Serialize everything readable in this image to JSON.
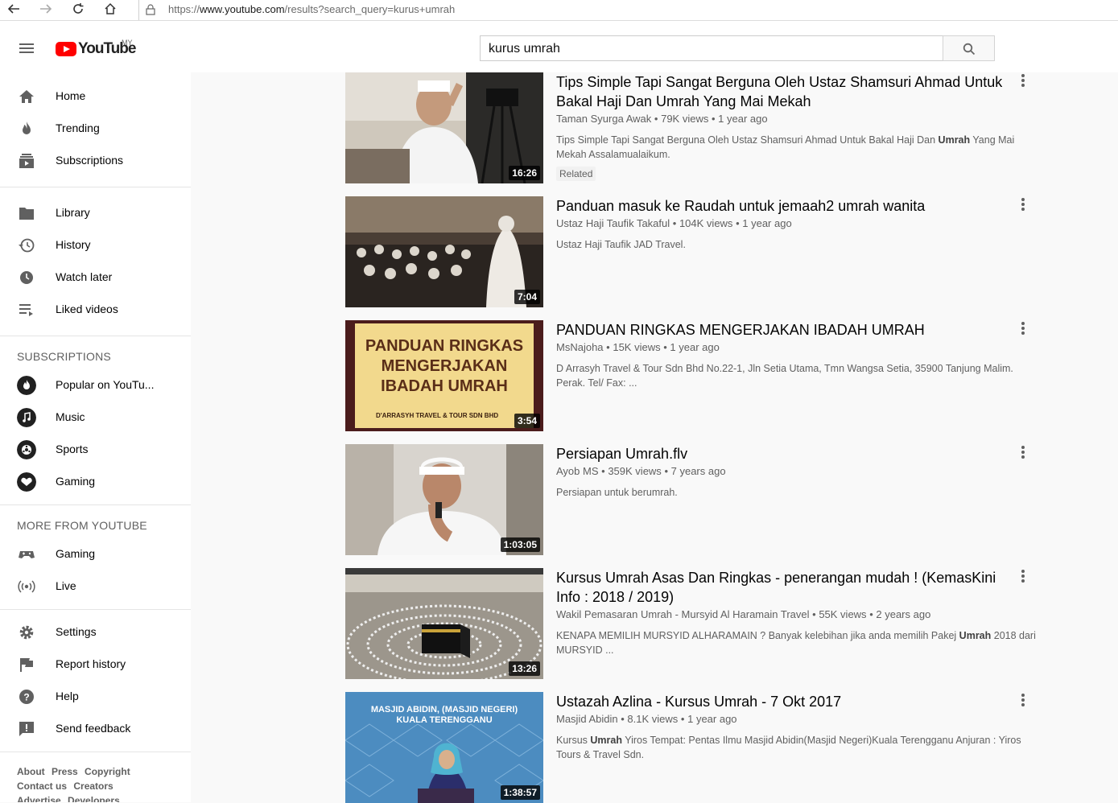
{
  "browser": {
    "url_prefix": "https://",
    "url_host": "www.youtube.com",
    "url_path": "/results?search_query=kurus+umrah"
  },
  "masthead": {
    "logo_text": "YouTube",
    "region": "MY",
    "search_value": "kurus umrah"
  },
  "sidebar": {
    "main": [
      {
        "label": "Home",
        "icon": "home-icon"
      },
      {
        "label": "Trending",
        "icon": "flame-icon"
      },
      {
        "label": "Subscriptions",
        "icon": "subscriptions-icon"
      }
    ],
    "library": [
      {
        "label": "Library",
        "icon": "folder-icon"
      },
      {
        "label": "History",
        "icon": "history-icon"
      },
      {
        "label": "Watch later",
        "icon": "clock-icon"
      },
      {
        "label": "Liked videos",
        "icon": "playlist-icon"
      }
    ],
    "subscriptions_heading": "SUBSCRIPTIONS",
    "subscriptions": [
      {
        "label": "Popular on YouTu..."
      },
      {
        "label": "Music"
      },
      {
        "label": "Sports"
      },
      {
        "label": "Gaming"
      }
    ],
    "more_heading": "MORE FROM YOUTUBE",
    "more": [
      {
        "label": "Gaming",
        "icon": "gamepad-icon"
      },
      {
        "label": "Live",
        "icon": "live-icon"
      }
    ],
    "settings": [
      {
        "label": "Settings",
        "icon": "gear-icon"
      },
      {
        "label": "Report history",
        "icon": "flag-icon"
      },
      {
        "label": "Help",
        "icon": "help-icon"
      },
      {
        "label": "Send feedback",
        "icon": "feedback-icon"
      }
    ],
    "footer_row1": [
      "About",
      "Press",
      "Copyright"
    ],
    "footer_row2": [
      "Contact us",
      "Creators"
    ],
    "footer_row3": [
      "Advertise",
      "Developers"
    ]
  },
  "videos": [
    {
      "title": "Tips Simple Tapi Sangat Berguna Oleh Ustaz Shamsuri Ahmad Untuk Bakal Haji Dan Umrah Yang Mai Mekah",
      "channel": "Taman Syurga Awak",
      "views": "79K views",
      "age": "1 year ago",
      "desc_a": "Tips Simple Tapi Sangat Berguna Oleh Ustaz Shamsuri Ahmad Untuk Bakal Haji Dan ",
      "desc_b": "Umrah",
      "desc_c": " Yang Mai Mekah Assalamualaikum.",
      "badge": "Related",
      "duration": "16:26"
    },
    {
      "title": "Panduan masuk ke Raudah untuk jemaah2 umrah wanita",
      "channel": "Ustaz Haji Taufik Takaful",
      "views": "104K views",
      "age": "1 year ago",
      "desc_a": "Ustaz Haji Taufik JAD Travel.",
      "desc_b": "",
      "desc_c": "",
      "duration": "7:04"
    },
    {
      "title": "PANDUAN RINGKAS MENGERJAKAN IBADAH UMRAH",
      "channel": "MsNajoha",
      "views": "15K views",
      "age": "1 year ago",
      "desc_a": "D Arrasyh Travel & Tour Sdn Bhd No.22-1, Jln Setia Utama, Tmn Wangsa Setia, 35900 Tanjung Malim. Perak. Tel/ Fax: ...",
      "desc_b": "",
      "desc_c": "",
      "duration": "3:54",
      "thumb_text_1": "PANDUAN RINGKAS",
      "thumb_text_2": "MENGERJAKAN",
      "thumb_text_3": "IBADAH UMRAH",
      "thumb_footer": "D'ARRASYH TRAVEL & TOUR SDN BHD"
    },
    {
      "title": "Persiapan Umrah.flv",
      "channel": "Ayob MS",
      "views": "359K views",
      "age": "7 years ago",
      "desc_a": "Persiapan untuk berumrah.",
      "desc_b": "",
      "desc_c": "",
      "duration": "1:03:05"
    },
    {
      "title": "Kursus Umrah Asas Dan Ringkas - penerangan mudah ! (KemasKini Info : 2018 / 2019)",
      "channel": "Wakil Pemasaran Umrah - Mursyid Al Haramain Travel",
      "views": "55K views",
      "age": "2 years ago",
      "desc_a": "KENAPA MEMILIH MURSYID ALHARAMAIN ? Banyak kelebihan jika anda memilih Pakej ",
      "desc_b": "Umrah",
      "desc_c": " 2018 dari MURSYID ...",
      "duration": "13:26"
    },
    {
      "title": "Ustazah Azlina - Kursus Umrah - 7 Okt 2017",
      "channel": "Masjid Abidin",
      "views": "8.1K views",
      "age": "1 year ago",
      "desc_a": "Kursus ",
      "desc_b": "Umrah",
      "desc_c": " Yiros Tempat: Pentas Ilmu Masjid Abidin(Masjid Negeri)Kuala Terengganu Anjuran : Yiros Tours & Travel Sdn.",
      "duration": "1:38:57",
      "thumb_text_1": "MASJID ABIDIN, (MASJID NEGERI)",
      "thumb_text_2": "KUALA TERENGGANU"
    }
  ],
  "separator": "•"
}
